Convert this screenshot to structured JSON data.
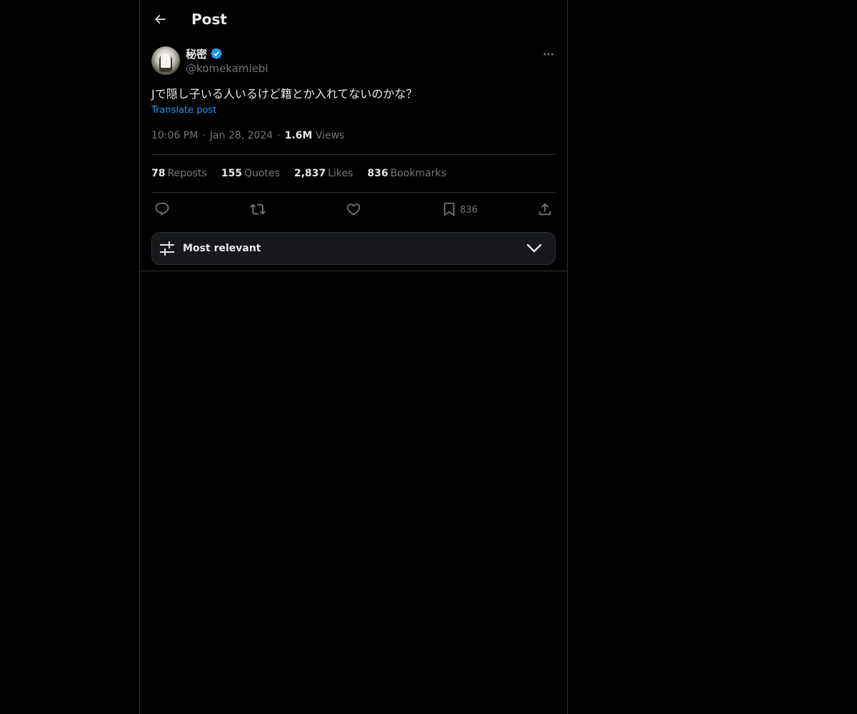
{
  "header": {
    "title": "Post"
  },
  "tweet": {
    "display_name": "秘密",
    "handle": "@komekamiebi",
    "verified": true,
    "text": "Jで隠し子いる人いるけど籍とか入れてないのかな？",
    "translate_label": "Translate post",
    "time": "10:06 PM",
    "date": "Jan 28, 2024",
    "views_count": "1.6M",
    "views_label": "Views"
  },
  "stats": {
    "reposts_count": "78",
    "reposts_label": "Reposts",
    "quotes_count": "155",
    "quotes_label": "Quotes",
    "likes_count": "2,837",
    "likes_label": "Likes",
    "bookmarks_count": "836",
    "bookmarks_label": "Bookmarks"
  },
  "actions": {
    "bookmark_count": "836"
  },
  "sort": {
    "label": "Most relevant"
  },
  "colors": {
    "background": "#000000",
    "text": "#e7e9ea",
    "muted": "#71767b",
    "accent": "#1d9bf0",
    "border": "#2f3336"
  }
}
